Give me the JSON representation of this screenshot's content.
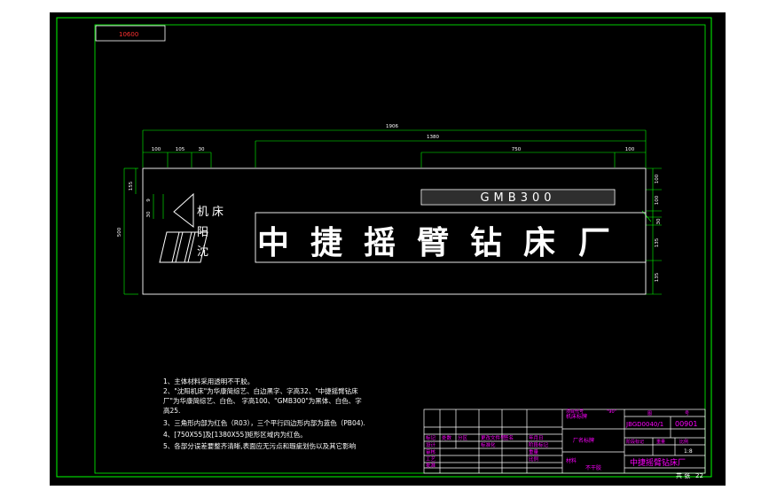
{
  "drawing": {
    "stamp_code": "10600",
    "overall_width": "1906",
    "dims_top": [
      "100",
      "105",
      "30"
    ],
    "dim_1380": "1380",
    "dim_750": "750",
    "dim_100_right": "100",
    "dims_left": [
      "155",
      "500"
    ],
    "dims_small": [
      "9",
      "30"
    ],
    "dims_right": [
      "100",
      "100",
      "30",
      "135",
      "135"
    ],
    "model_plate": "GMB300",
    "sign_characters": [
      "中",
      "捷",
      "摇",
      "臂",
      "钻",
      "床",
      "厂"
    ],
    "logo_chars": [
      "沈",
      "阳",
      "机",
      "床"
    ]
  },
  "notes": [
    "1、主体材料采用透明不干胶。",
    "2、\"沈阳机床\"为华康简综艺、白边黑字、字高32、\"中捷摇臂钻床",
    "厂\"为华康简综艺、白色、    字高100、\"GMB300\"为黑体、白色、字",
    "高25.",
    "3、三角形内部为红色（R03），三个平行四边形内部为蓝色（PB04).",
    "4、[750X55]及[1380X55]矩形区域内为红色。",
    "5、各部分误差要整齐清晰,表面应无污点和瑕疵划伤以及其它影响"
  ],
  "title_block": {
    "cells_left": [
      "标记",
      "处数",
      "分区",
      "更改文件号",
      "签名",
      "年月日",
      "设计",
      "标准化",
      "阶段标记",
      "重量",
      "比例",
      "审核",
      "工艺",
      "批准"
    ],
    "drawing_name": "机床标牌",
    "project": "厂名标牌",
    "material_label": "材料",
    "material": "不干胶",
    "top_labels": [
      "项目代号",
      "型号",
      "名称"
    ],
    "model": "\"90\"",
    "code_labels": [
      "图",
      "号"
    ],
    "drawing_number_a": "JBGD0040/1",
    "drawing_number_b": "00901",
    "sub_labels": [
      "阶段标记",
      "重量",
      "比例"
    ],
    "scale": "1:8",
    "company": "中捷摇臂钻床厂",
    "sheet_label": "共  张",
    "sheet": "22"
  },
  "colors": {
    "background": "#000000",
    "frame": "#00ff00",
    "sign_lines": "#ffffff",
    "dimension": "#00ff00",
    "title_text": "#ff00ff"
  }
}
